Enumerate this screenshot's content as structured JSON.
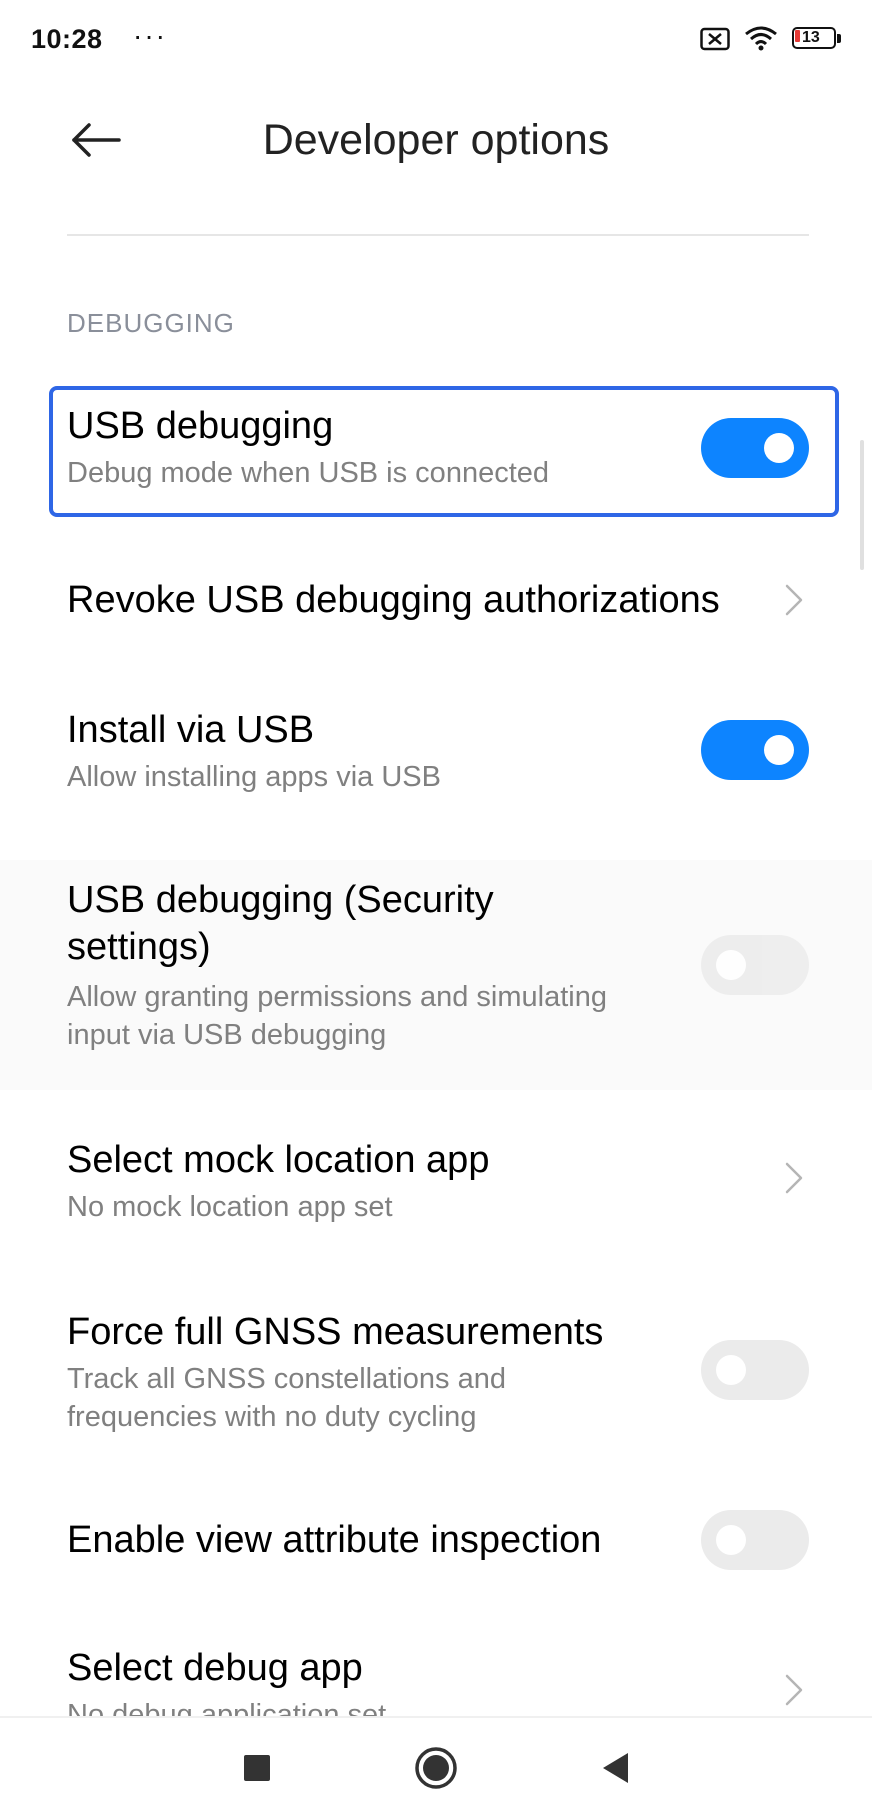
{
  "status_bar": {
    "time": "10:28",
    "more": "···",
    "battery_level": "13",
    "icons": [
      "sim-off-icon",
      "wifi-icon",
      "battery-icon"
    ]
  },
  "header": {
    "title": "Developer options",
    "back_icon": "arrow-left-icon"
  },
  "section": {
    "label": "DEBUGGING"
  },
  "items": [
    {
      "title": "USB debugging",
      "subtitle": "Debug mode when USB is connected",
      "control": "toggle",
      "state": "on",
      "highlighted": true
    },
    {
      "title": "Revoke USB debugging authorizations",
      "control": "chevron"
    },
    {
      "title": "Install via USB",
      "subtitle": "Allow installing apps via USB",
      "control": "toggle",
      "state": "on"
    },
    {
      "title_line1": "USB debugging (Security",
      "title_line2": "settings)",
      "subtitle_line1": "Allow granting permissions and simulating",
      "subtitle_line2": "input via USB debugging",
      "control": "toggle",
      "state": "off",
      "disabled": true
    },
    {
      "title": "Select mock location app",
      "subtitle": "No mock location app set",
      "control": "chevron"
    },
    {
      "title": "Force full GNSS measurements",
      "subtitle_line1": "Track all GNSS constellations and",
      "subtitle_line2": "frequencies with no duty cycling",
      "control": "toggle",
      "state": "off"
    },
    {
      "title": "Enable view attribute inspection",
      "control": "toggle",
      "state": "off"
    },
    {
      "title": "Select debug app",
      "subtitle": "No debug application set",
      "control": "chevron"
    }
  ],
  "nav_bar": {
    "buttons": [
      "recents-square-icon",
      "home-circle-icon",
      "back-triangle-icon"
    ]
  },
  "colors": {
    "accent": "#0d84ff",
    "highlight_border": "#2e66e6",
    "toggle_off": "#ebebeb",
    "subtitle": "#808080",
    "section_label": "#8a8f9a"
  }
}
